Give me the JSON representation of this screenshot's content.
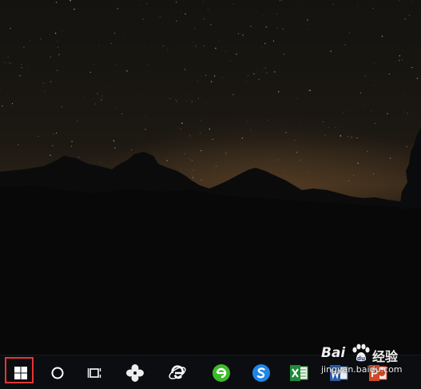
{
  "taskbar": {
    "icons": [
      {
        "name": "start-button",
        "icon": "windows-logo-icon"
      },
      {
        "name": "cortana-button",
        "icon": "circle-icon"
      },
      {
        "name": "task-view-button",
        "icon": "task-view-icon"
      },
      {
        "name": "pinwheel-app",
        "icon": "pinwheel-icon"
      },
      {
        "name": "internet-explorer",
        "icon": "ie-icon"
      },
      {
        "name": "green-browser",
        "icon": "green-e-icon"
      },
      {
        "name": "sogou-browser",
        "icon": "sogou-s-icon"
      },
      {
        "name": "excel",
        "icon": "excel-icon"
      },
      {
        "name": "word",
        "icon": "word-icon"
      },
      {
        "name": "powerpoint",
        "icon": "powerpoint-icon"
      }
    ]
  },
  "watermark": {
    "brand": "Bai",
    "brand_suffix": "经验",
    "url": "jingyan.baidu.com"
  },
  "colors": {
    "highlight": "#e53535",
    "taskbar": "#0b0d10"
  }
}
